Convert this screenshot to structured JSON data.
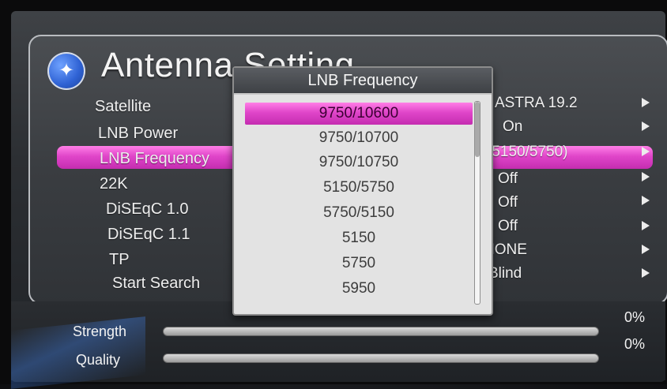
{
  "window": {
    "title": "Antenna Setting"
  },
  "menu": {
    "labels": [
      "Satellite",
      "LNB Power",
      "LNB Frequency",
      "22K",
      "DiSEqC 1.0",
      "DiSEqC 1.1",
      "TP",
      "Start Search"
    ],
    "values": [
      "ASTRA 19.2",
      "On",
      "(5150/5750)",
      "Off",
      "Off",
      "Off",
      "NONE",
      "Blind"
    ],
    "selected_index": 2
  },
  "popup": {
    "title": "LNB Frequency",
    "options": [
      "9750/10600",
      "9750/10700",
      "9750/10750",
      "5150/5750",
      "5750/5150",
      "5150",
      "5750",
      "5950"
    ],
    "selected_index": 0
  },
  "signal": {
    "strength_label": "Strength",
    "strength_value": "0%",
    "strength_fraction": 0,
    "quality_label": "Quality",
    "quality_value": "0%",
    "quality_fraction": 0
  },
  "colors": {
    "highlight": "#e045c9",
    "icon_blue": "#2f62d4"
  },
  "icons": {
    "header_icon": "satellite-icon",
    "row_arrow": "arrow-right-icon"
  }
}
